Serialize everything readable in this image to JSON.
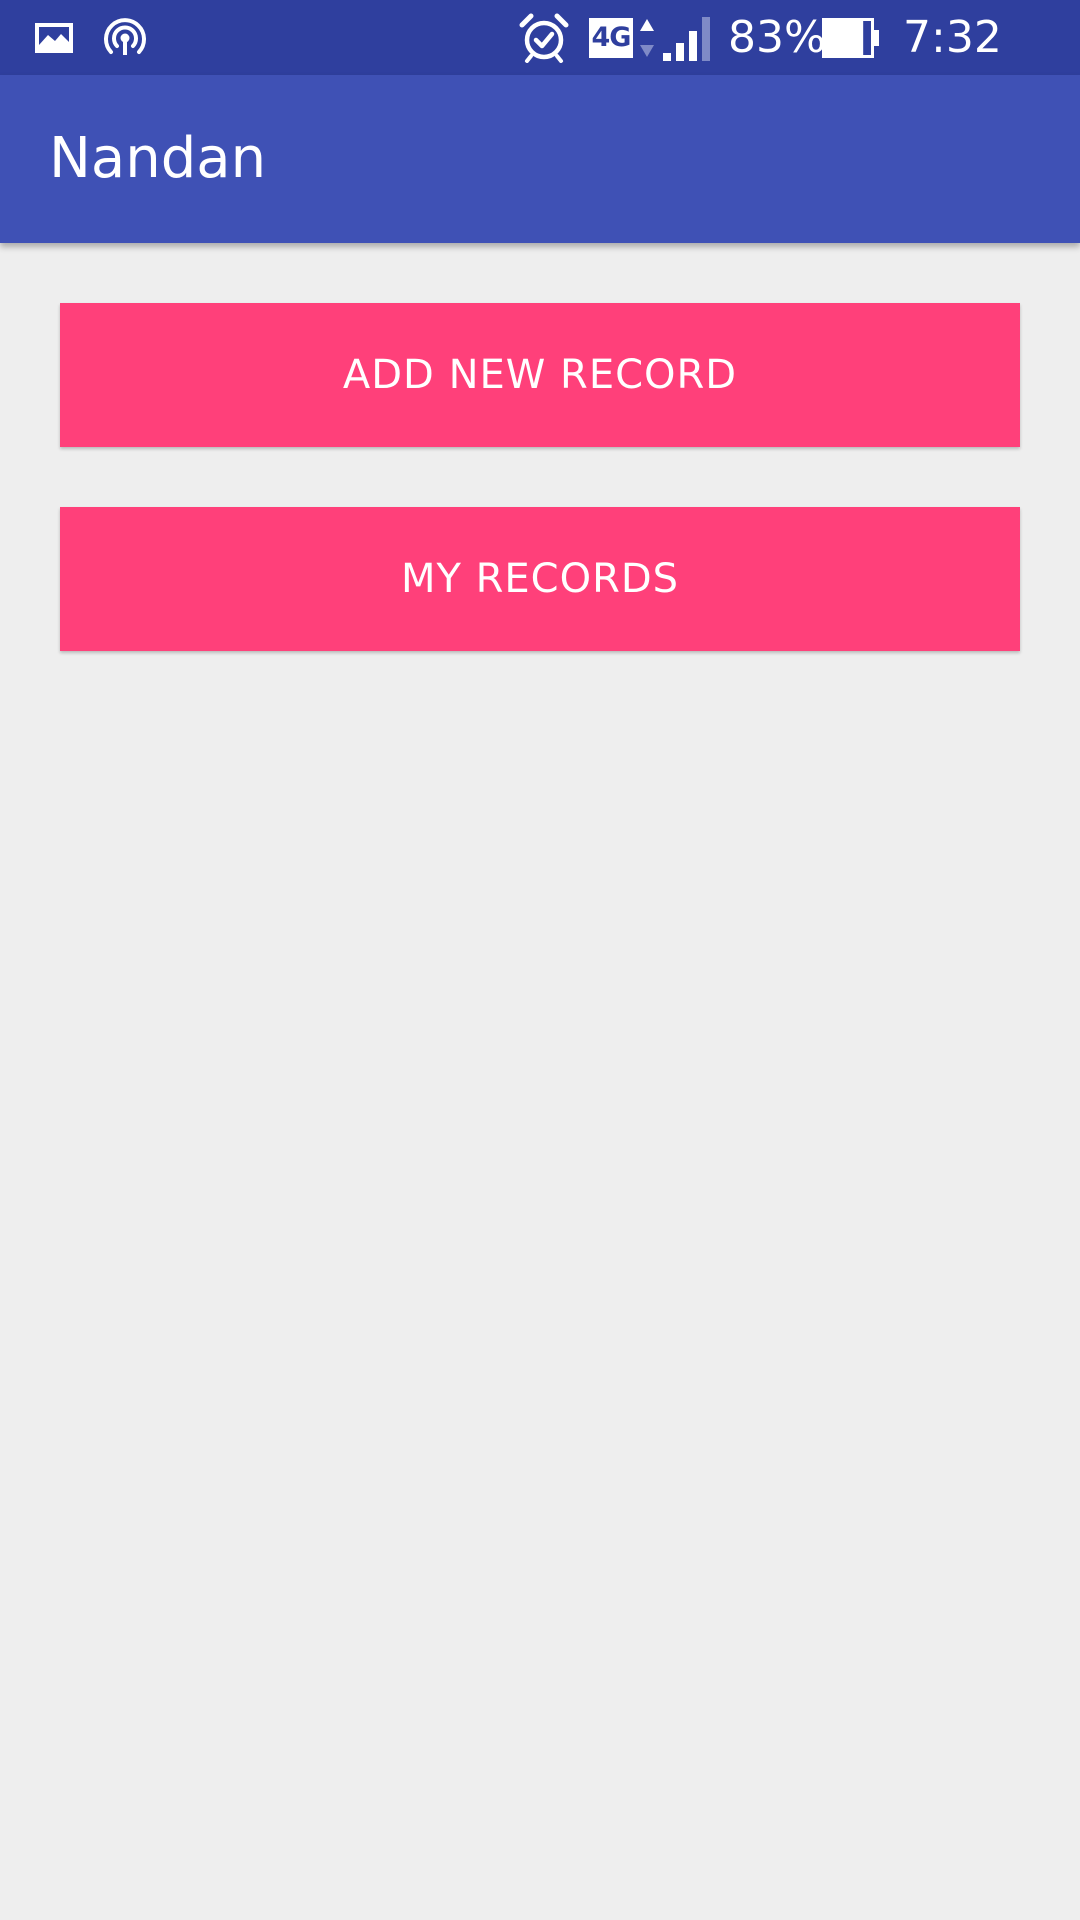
{
  "status_bar": {
    "icons": {
      "left": [
        "photo-icon",
        "hotspot-icon"
      ],
      "right": [
        "alarm-icon",
        "network-4g-icon",
        "signal-icon",
        "battery-icon"
      ]
    },
    "network_type": "4G",
    "battery_percent": "83%",
    "time": "7:32 PM",
    "battery_level": 0.83,
    "signal_level": 3
  },
  "app_bar": {
    "title": "Nandan"
  },
  "actions": {
    "add_new_record": "ADD NEW RECORD",
    "my_records": "MY RECORDS"
  },
  "colors": {
    "status_bar": "#2f3f9e",
    "app_bar": "#3f51b5",
    "accent": "#ff407a",
    "background": "#eeeeee"
  }
}
